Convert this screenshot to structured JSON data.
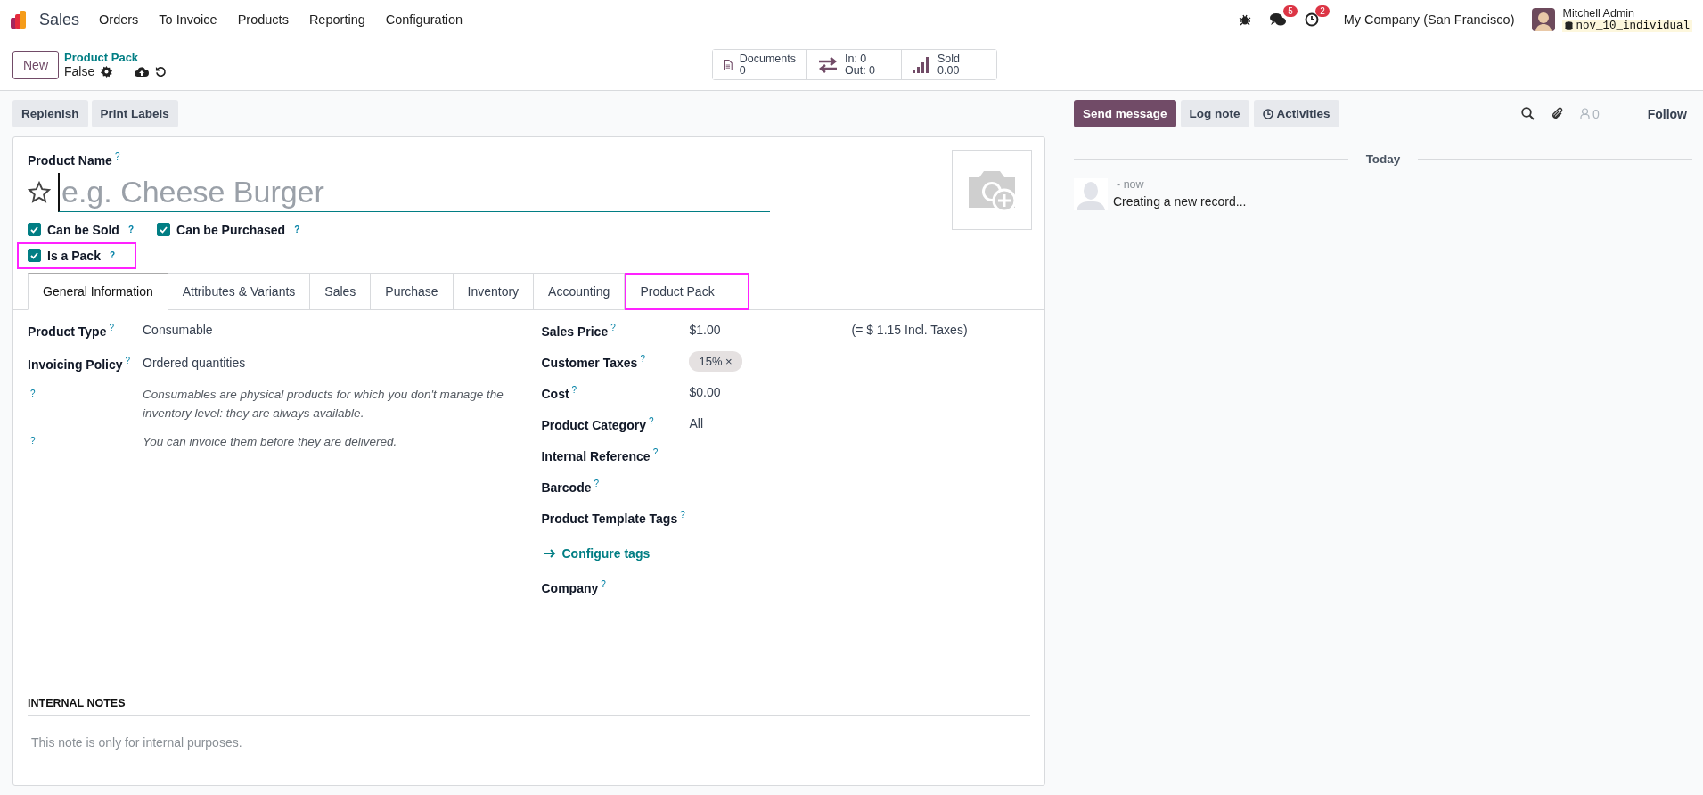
{
  "app": {
    "name": "Sales"
  },
  "menu": [
    "Orders",
    "To Invoice",
    "Products",
    "Reporting",
    "Configuration"
  ],
  "systray": {
    "messages_count": "5",
    "activities_count": "2",
    "company": "My Company (San Francisco)",
    "user": "Mitchell Admin",
    "database": "nov_10_individual"
  },
  "breadcrumb": {
    "parent": "Product Pack",
    "current": "False"
  },
  "new_button": "New",
  "stat_buttons": [
    {
      "kind": "documents",
      "lines": [
        "Documents",
        "0"
      ]
    },
    {
      "kind": "moves",
      "lines": [
        "In: 0",
        "Out: 0"
      ]
    },
    {
      "kind": "sold",
      "lines": [
        "Sold",
        "0.00"
      ]
    }
  ],
  "actions": [
    "Replenish",
    "Print Labels"
  ],
  "form": {
    "name_label": "Product Name",
    "name_tooltip": "?",
    "name_placeholder": "e.g. Cheese Burger",
    "favorite": false,
    "checkboxes": [
      {
        "label": "Can be Sold",
        "tooltip": "?",
        "checked": true,
        "highlighted": false
      },
      {
        "label": "Can be Purchased",
        "tooltip": "?",
        "checked": true,
        "highlighted": false
      },
      {
        "label": "Is a Pack",
        "tooltip": "?",
        "checked": true,
        "highlighted": true
      }
    ],
    "tabs": [
      {
        "label": "General Information",
        "selected": true,
        "highlighted": false
      },
      {
        "label": "Attributes & Variants",
        "selected": false,
        "highlighted": false
      },
      {
        "label": "Sales",
        "selected": false,
        "highlighted": false
      },
      {
        "label": "Purchase",
        "selected": false,
        "highlighted": false
      },
      {
        "label": "Inventory",
        "selected": false,
        "highlighted": false
      },
      {
        "label": "Accounting",
        "selected": false,
        "highlighted": false
      },
      {
        "label": "Product Pack",
        "selected": false,
        "highlighted": true
      }
    ],
    "left_fields": [
      {
        "kind": "field",
        "label": "Product Type",
        "tooltip": "?",
        "value": "Consumable"
      },
      {
        "kind": "field",
        "label": "Invoicing Policy",
        "tooltip": "?",
        "value": "Ordered quantities"
      },
      {
        "kind": "help",
        "tooltip": "?",
        "text": "Consumables are physical products for which you don't manage the inventory level: they are always available."
      },
      {
        "kind": "help",
        "tooltip": "?",
        "text": "You can invoice them before they are delivered."
      }
    ],
    "right_fields": [
      {
        "kind": "field",
        "label": "Sales Price",
        "tooltip": "?",
        "value": "$1.00",
        "extra": "(= $ 1.15 Incl. Taxes)"
      },
      {
        "kind": "tags",
        "label": "Customer Taxes",
        "tooltip": "?",
        "tags": [
          "15%"
        ],
        "remove_mark": "×"
      },
      {
        "kind": "field",
        "label": "Cost",
        "tooltip": "?",
        "value": "$0.00"
      },
      {
        "kind": "field",
        "label": "Product Category",
        "tooltip": "?",
        "value": "All"
      },
      {
        "kind": "field",
        "label": "Internal Reference",
        "tooltip": "?"
      },
      {
        "kind": "field",
        "label": "Barcode",
        "tooltip": "?"
      },
      {
        "kind": "field",
        "label": "Product Template Tags",
        "tooltip": "?"
      },
      {
        "kind": "link",
        "text": "Configure tags"
      },
      {
        "kind": "field",
        "label": "Company",
        "tooltip": "?"
      }
    ],
    "notes": {
      "title": "INTERNAL NOTES",
      "placeholder": "This note is only for internal purposes."
    }
  },
  "chatter": {
    "buttons": [
      {
        "kind": "send",
        "label": "Send message"
      },
      {
        "kind": "log",
        "label": "Log note"
      },
      {
        "kind": "activities",
        "label": "Activities"
      }
    ],
    "followers_count": "0",
    "follow": "Follow",
    "date_separator": "Today",
    "messages": [
      {
        "time": "- now",
        "body": "Creating a new record..."
      }
    ]
  }
}
